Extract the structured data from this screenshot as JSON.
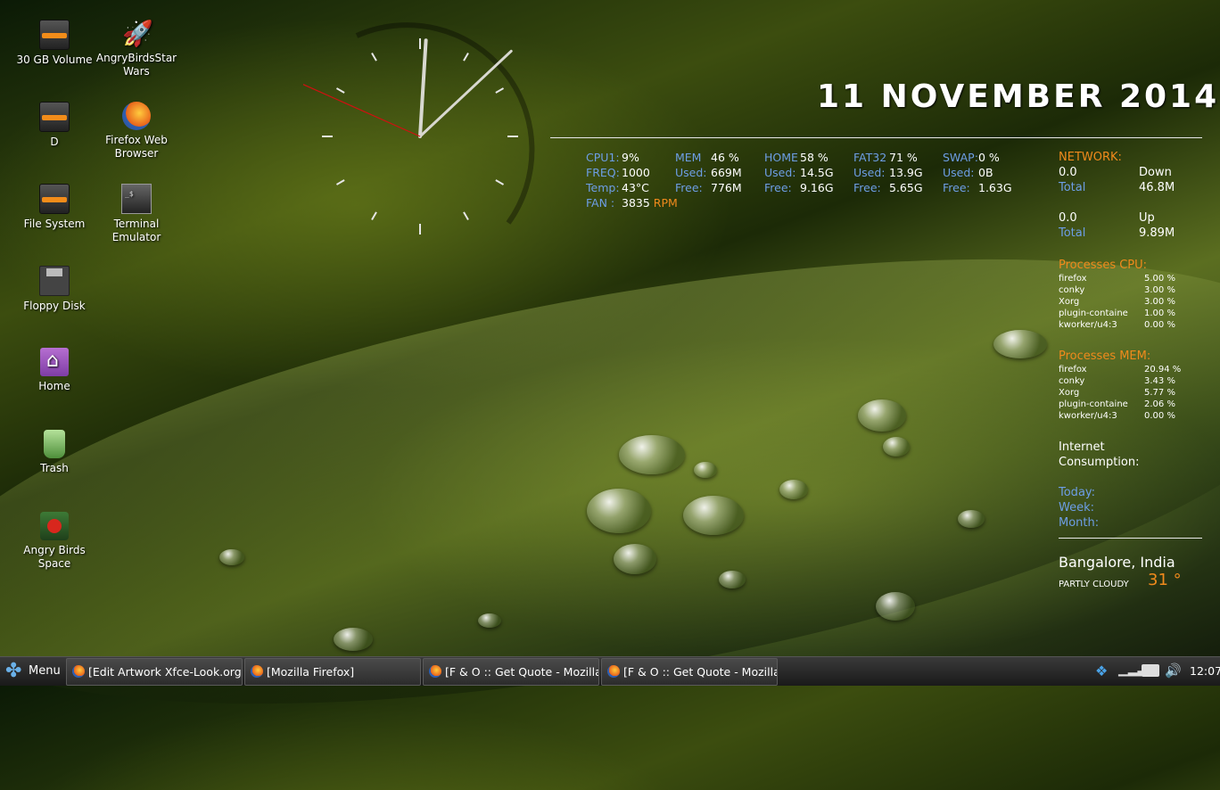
{
  "desktop": {
    "icons": [
      {
        "label": "30 GB Volume",
        "icon": "drive-icon"
      },
      {
        "label": "AngryBirdsStar Wars",
        "icon": "rocket-icon"
      },
      {
        "label": "D",
        "icon": "drive-icon"
      },
      {
        "label": "Firefox Web Browser",
        "icon": "firefox-icon"
      },
      {
        "label": "File System",
        "icon": "drive-icon"
      },
      {
        "label": "Terminal Emulator",
        "icon": "terminal-icon"
      },
      {
        "label": "Floppy Disk",
        "icon": "floppy-icon"
      },
      {
        "label": "Home",
        "icon": "home-folder-icon"
      },
      {
        "label": "Trash",
        "icon": "trash-icon"
      },
      {
        "label": "Angry Birds Space",
        "icon": "angry-birds-icon"
      }
    ]
  },
  "conky": {
    "date": "11 NOVEMBER 2014",
    "cpu": {
      "l1": "CPU1:",
      "v1": "9%",
      "l2": "FREQ:",
      "v2": "1000",
      "l3": "Temp:",
      "v3": "43°C",
      "l4": "FAN :",
      "v4": "3835",
      "u4": "RPM"
    },
    "mem": {
      "title": "MEM",
      "pct": "46 %",
      "used_l": "Used:",
      "used": "669M",
      "free_l": "Free:",
      "free": "776M"
    },
    "home": {
      "title": "HOME",
      "pct": "58 %",
      "used_l": "Used:",
      "used": "14.5G",
      "free_l": "Free:",
      "free": "9.16G"
    },
    "fat32": {
      "title": "FAT32",
      "pct": "71 %",
      "used_l": "Used:",
      "used": "13.9G",
      "free_l": "Free:",
      "free": "5.65G"
    },
    "swap": {
      "title": "SWAP:",
      "pct": "0 %",
      "used_l": "Used:",
      "used": "0B",
      "free_l": "Free:",
      "free": "1.63G"
    },
    "network": {
      "title": "NETWORK:",
      "down_rate": "0.0",
      "down_label": "Down",
      "down_total_l": "Total",
      "down_total": "46.8M",
      "up_rate": "0.0",
      "up_label": "Up",
      "up_total_l": "Total",
      "up_total": "9.89M"
    },
    "proc_cpu": {
      "title": "Processes CPU:",
      "rows": [
        {
          "name": "firefox",
          "val": "5.00 %"
        },
        {
          "name": "conky",
          "val": "3.00 %"
        },
        {
          "name": "Xorg",
          "val": "3.00 %"
        },
        {
          "name": "plugin-containe",
          "val": "1.00 %"
        },
        {
          "name": "kworker/u4:3",
          "val": "0.00 %"
        }
      ]
    },
    "proc_mem": {
      "title": "Processes MEM:",
      "rows": [
        {
          "name": "firefox",
          "val": "20.94 %"
        },
        {
          "name": "conky",
          "val": "3.43 %"
        },
        {
          "name": "Xorg",
          "val": "5.77 %"
        },
        {
          "name": "plugin-containe",
          "val": "2.06 %"
        },
        {
          "name": "kworker/u4:3",
          "val": "0.00 %"
        }
      ]
    },
    "internet": {
      "title1": "Internet",
      "title2": "Consumption:",
      "today": "Today:",
      "week": "Week:",
      "month": "Month:"
    },
    "weather": {
      "city": "Bangalore, India",
      "cond": "PARTLY CLOUDY",
      "temp": "31 °"
    }
  },
  "taskbar": {
    "menu_label": "Menu",
    "tasks": [
      "[Edit  Artwork Xfce-Look.org - ...",
      "[Mozilla Firefox]",
      "[F & O :: Get Quote - Mozilla Fi...",
      "[F & O :: Get Quote - Mozilla Fi..."
    ],
    "clock": "12:07"
  },
  "analog_clock": {
    "hour": 12,
    "minute": 7,
    "second": 49
  }
}
